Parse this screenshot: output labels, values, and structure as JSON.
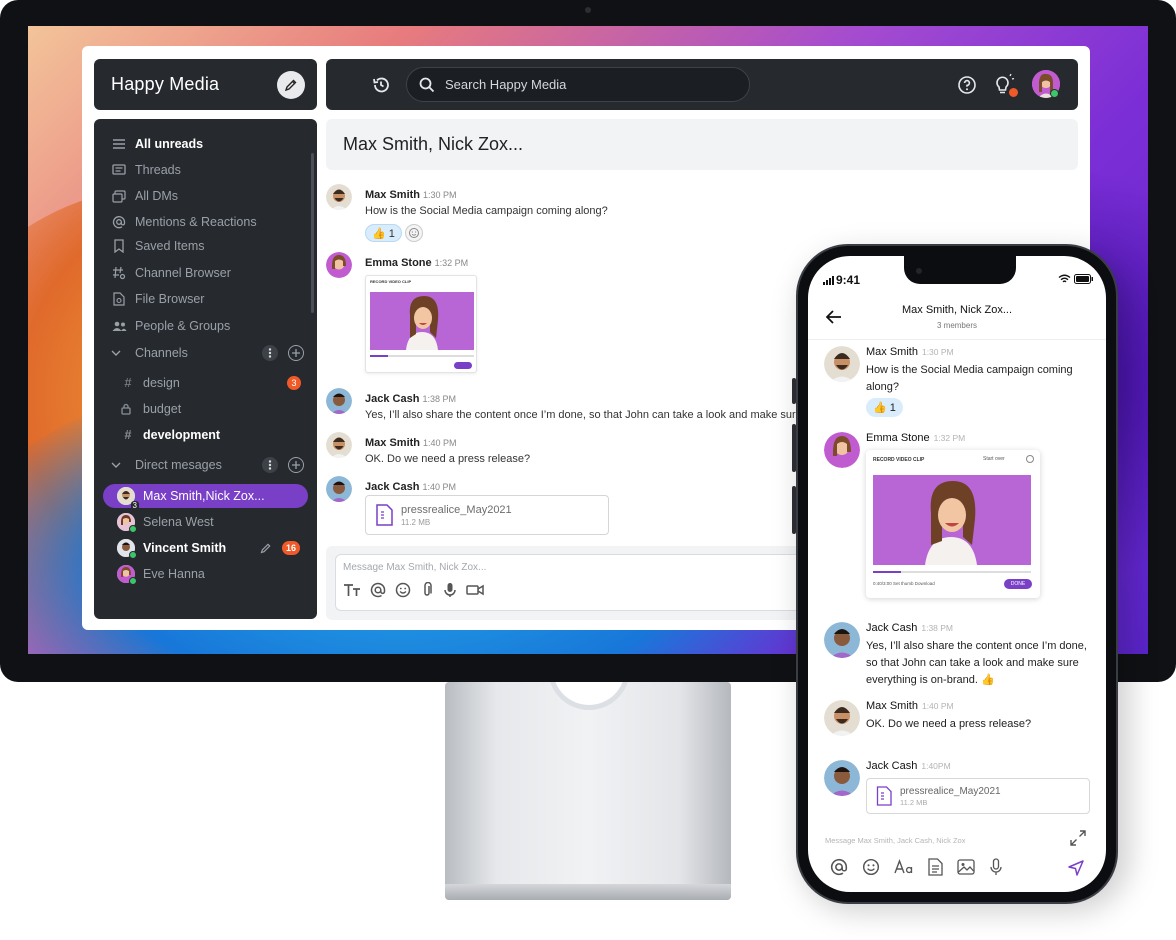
{
  "desktop": {
    "workspace_name": "Happy Media",
    "search_placeholder": "Search Happy Media",
    "sidebar": {
      "nav": [
        {
          "label": "All unreads",
          "icon": "list-icon",
          "bold": true
        },
        {
          "label": "Threads",
          "icon": "threads-icon"
        },
        {
          "label": "All DMs",
          "icon": "dms-icon"
        },
        {
          "label": "Mentions & Reactions",
          "icon": "at-icon"
        },
        {
          "label": "Saved Items",
          "icon": "bookmark-icon"
        },
        {
          "label": "Channel Browser",
          "icon": "channel-browser-icon"
        },
        {
          "label": "File Browser",
          "icon": "file-browser-icon"
        },
        {
          "label": "People & Groups",
          "icon": "people-icon"
        }
      ],
      "channels_label": "Channels",
      "channels": [
        {
          "name": "design",
          "icon": "#",
          "badge": "3"
        },
        {
          "name": "budget",
          "icon": "lock"
        },
        {
          "name": "development",
          "icon": "#",
          "bold": true
        }
      ],
      "dms_label": "Direct mesages",
      "dms": [
        {
          "name": "Max Smith,Nick Zox...",
          "count": "3",
          "active": true
        },
        {
          "name": "Selena West"
        },
        {
          "name": "Vincent Smith",
          "badge": "16",
          "bold": true
        },
        {
          "name": "Eve Hanna"
        }
      ]
    },
    "chat_title": "Max Smith, Nick Zox...",
    "messages": [
      {
        "author": "Max Smith",
        "time": "1:30 PM",
        "text": "How is the Social Media campaign coming along?",
        "reaction": "👍 1"
      },
      {
        "author": "Emma Stone",
        "time": "1:32 PM",
        "clip_title": "RECORD VIDEO CLIP"
      },
      {
        "author": "Jack Cash",
        "time": "1:38 PM",
        "text": "Yes, I’ll also share the content once I’m done, so that John can take a look and make sure everyth"
      },
      {
        "author": "Max Smith",
        "time": "1:40 PM",
        "text": "OK. Do we need a press release?"
      },
      {
        "author": "Jack Cash",
        "time": "1:40 PM",
        "file_name": "pressrealice_May2021",
        "file_size": "11.2 MB"
      }
    ],
    "composer_placeholder": "Message Max Smith, Nick Zox..."
  },
  "phone": {
    "status_time": "9:41",
    "title": "Max Smith, Nick Zox...",
    "subtitle": "3 members",
    "messages": [
      {
        "author": "Max Smith",
        "time": "1:30 PM",
        "text": "How is the Social Media campaign coming along?",
        "reaction": "👍 1"
      },
      {
        "author": "Emma Stone",
        "time": "1:32 PM",
        "clip_title": "RECORD VIDEO CLIP",
        "clip_start_over": "Start over",
        "clip_controls": "0:40/3:00     Set thumb     Download",
        "clip_done": "DONE"
      },
      {
        "author": "Jack Cash",
        "time": "1:38 PM",
        "text": "Yes, I’ll also share the content once I’m done, so that John can take a look and make sure everything is on-brand. 👍"
      },
      {
        "author": "Max Smith",
        "time": "1:40 PM",
        "text": "OK. Do we need a press release?"
      },
      {
        "author": "Jack Cash",
        "time": "1:40PM",
        "file_name": "pressrealice_May2021",
        "file_size": "11.2 MB"
      }
    ],
    "composer_placeholder": "Message Max Smith, Jack Cash, Nick Zox"
  },
  "colors": {
    "accent": "#7a3fc7",
    "sidebar_bg": "#262a2f",
    "badge": "#f05a28",
    "online": "#3cc56a"
  }
}
